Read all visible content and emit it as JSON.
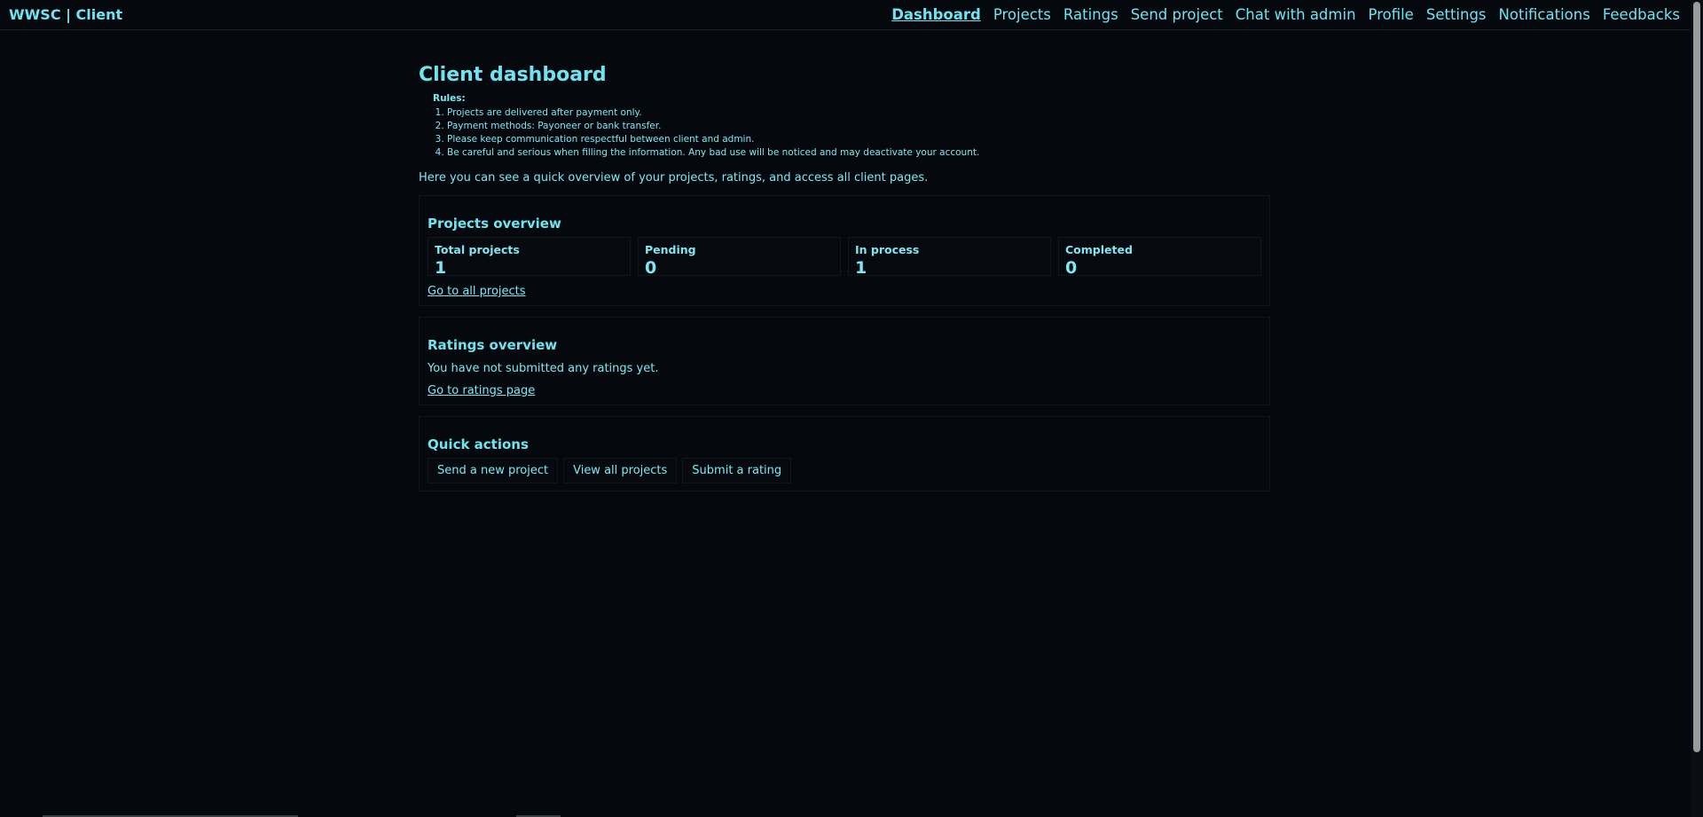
{
  "brand": "WWSC | Client",
  "nav": [
    "Dashboard",
    "Projects",
    "Ratings",
    "Send project",
    "Chat with admin",
    "Profile",
    "Settings",
    "Notifications",
    "Feedbacks"
  ],
  "page_title": "Client dashboard",
  "rules": {
    "title": "Rules:",
    "items": [
      "Projects are delivered after payment only.",
      "Payment methods: Payoneer or bank transfer.",
      "Please keep communication respectful between client and admin.",
      "Be careful and serious when filling the information. Any bad use will be noticed and may deactivate your account."
    ]
  },
  "intro": "Here you can see a quick overview of your projects, ratings, and access all client pages.",
  "projects_overview": {
    "title": "Projects overview",
    "stats": [
      {
        "label": "Total projects",
        "value": "1"
      },
      {
        "label": "Pending",
        "value": "0"
      },
      {
        "label": "In process",
        "value": "1"
      },
      {
        "label": "Completed",
        "value": "0"
      }
    ],
    "link": "Go to all projects"
  },
  "ratings_overview": {
    "title": "Ratings overview",
    "message": "You have not submitted any ratings yet.",
    "link": "Go to ratings page"
  },
  "quick_actions": {
    "title": "Quick actions",
    "buttons": [
      "Send a new project",
      "View all projects",
      "Submit a rating"
    ]
  },
  "colors": {
    "background": "#05080d",
    "accent": "#6fe4f0"
  }
}
